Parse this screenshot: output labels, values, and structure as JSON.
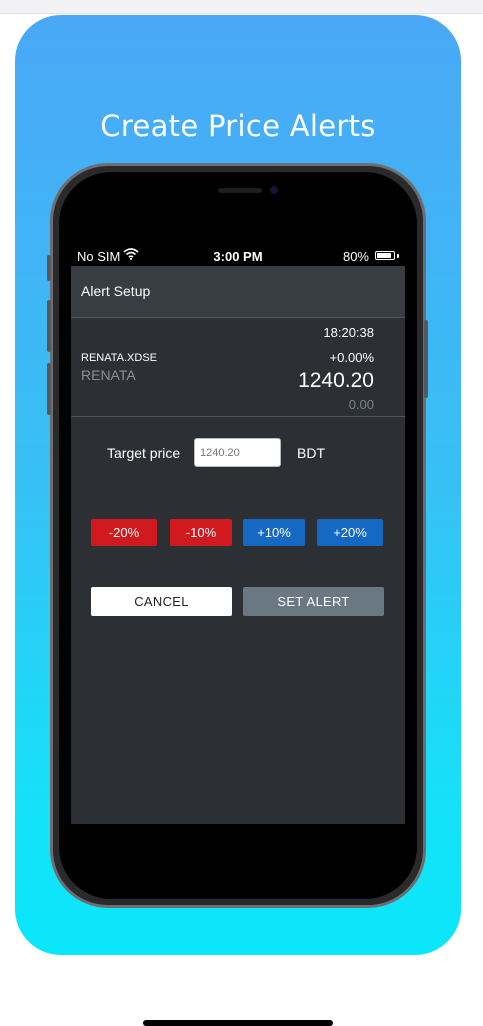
{
  "promo": {
    "title": "Create Price Alerts"
  },
  "status_bar": {
    "carrier": "No SIM",
    "time": "3:00 PM",
    "battery": "80%",
    "battery_level": 0.8
  },
  "nav": {
    "title": "Alert Setup"
  },
  "quote": {
    "time": "18:20:38",
    "symbol": "RENATA.XDSE",
    "name": "RENATA",
    "change_pct": "+0.00%",
    "price": "1240.20",
    "change_abs": "0.00"
  },
  "target": {
    "label": "Target price",
    "value": "1240.20",
    "unit": "BDT"
  },
  "adjust_buttons": [
    {
      "label": "-20%",
      "color": "#d11a1f"
    },
    {
      "label": "-10%",
      "color": "#d11a1f"
    },
    {
      "label": "+10%",
      "color": "#1569c3"
    },
    {
      "label": "+20%",
      "color": "#1569c3"
    }
  ],
  "actions": {
    "cancel": "CANCEL",
    "set_alert": "SET ALERT"
  },
  "colors": {
    "card_gradient_top": "#4aa8f6",
    "card_gradient_bottom": "#0ae7fb",
    "screen_bg": "#2c3034",
    "nav_bg": "#373d42",
    "set_alert_bg": "#6a7884"
  }
}
